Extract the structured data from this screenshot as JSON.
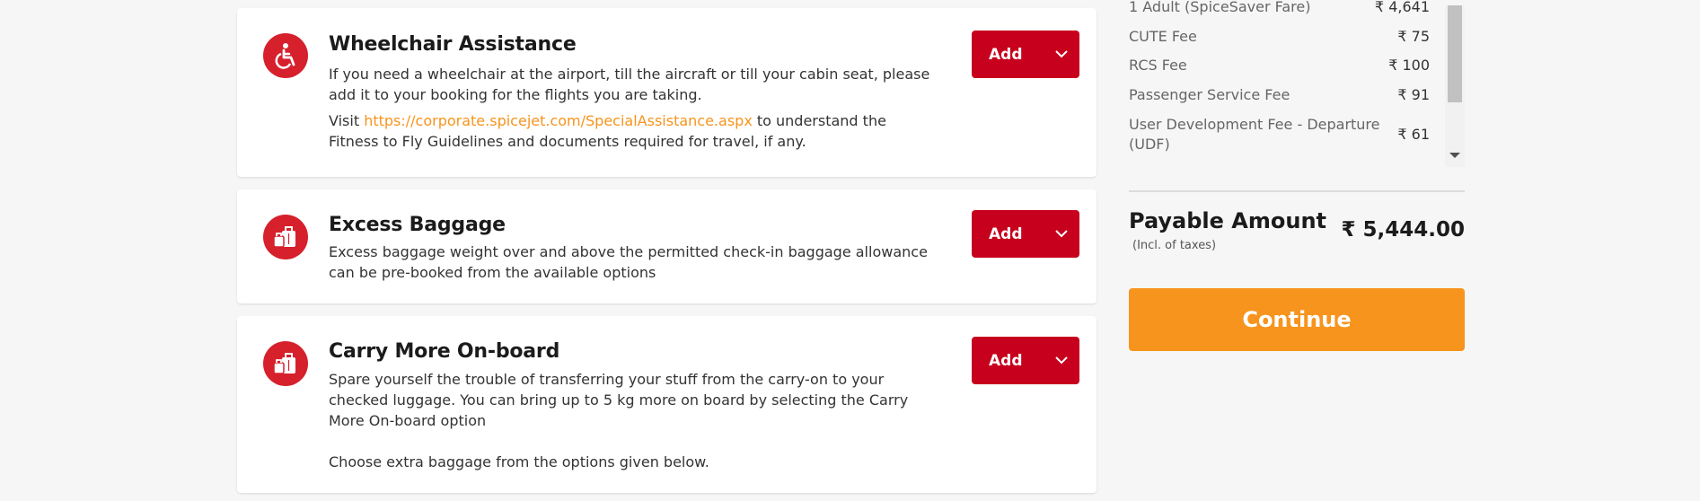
{
  "services": [
    {
      "title": "Wheelchair Assistance",
      "icon": "wheelchair-icon",
      "desc_line1": "If you need a wheelchair at the airport, till the aircraft or till your cabin seat, please add it to your booking for the flights you are taking.",
      "desc_visit_prefix": "Visit ",
      "desc_link": "https://corporate.spicejet.com/SpecialAssistance.aspx",
      "desc_visit_suffix": " to understand the Fitness to Fly Guidelines and documents required for travel, if any.",
      "button_label": "Add"
    },
    {
      "title": "Excess Baggage",
      "icon": "baggage-icon",
      "desc": "Excess baggage weight over and above the permitted check-in baggage allowance can be pre-booked from the available options",
      "button_label": "Add"
    },
    {
      "title": "Carry More On-board",
      "icon": "baggage-icon",
      "desc": "Spare yourself the trouble of transferring your stuff from the carry-on to your checked luggage. You can bring up to 5 kg more on board by selecting the Carry More On-board option",
      "desc_extra": "Choose extra baggage from the options given below.",
      "button_label": "Add"
    }
  ],
  "fare_summary": {
    "rows": [
      {
        "label": "1 Adult  (SpiceSaver Fare)",
        "amount": "₹ 4,641"
      },
      {
        "label": "CUTE Fee",
        "amount": "₹ 75"
      },
      {
        "label": "RCS Fee",
        "amount": "₹ 100"
      },
      {
        "label": "Passenger Service Fee",
        "amount": "₹ 91"
      },
      {
        "label": "User Development Fee - Departure (UDF)",
        "amount": "₹ 61"
      }
    ],
    "scroll_position": 0.0
  },
  "payable": {
    "label": "Payable Amount",
    "sublabel": "(Incl. of taxes)",
    "amount": "₹ 5,444.00"
  },
  "continue_label": "Continue",
  "colors": {
    "brand_red": "#c7001d",
    "icon_red": "#d6202c",
    "link_orange": "#f7941d",
    "continue_orange": "#f7941d"
  }
}
